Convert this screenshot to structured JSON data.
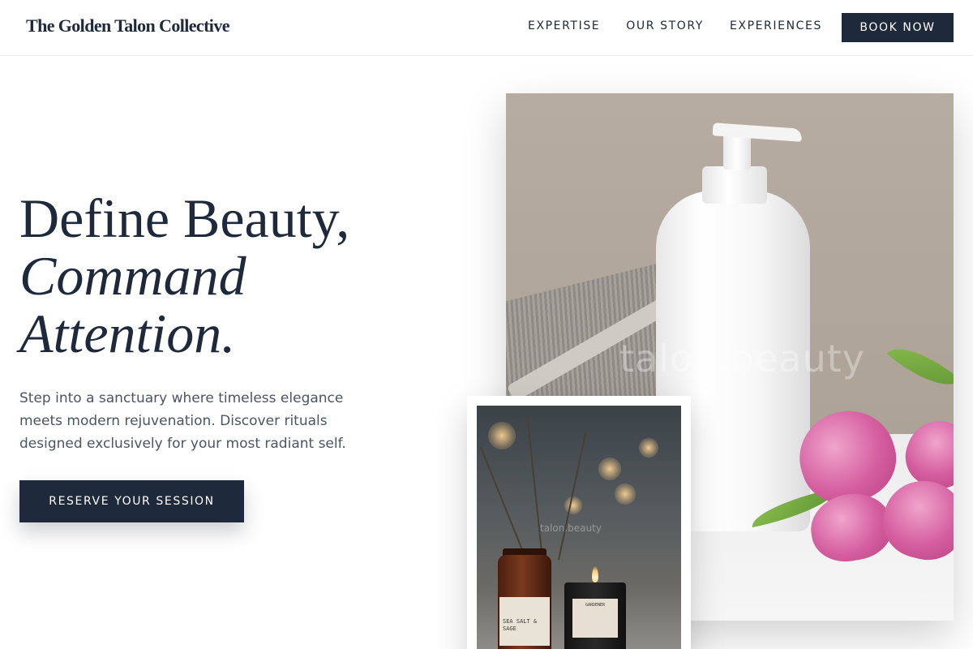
{
  "header": {
    "brand": "The Golden Talon Collective",
    "nav": [
      {
        "label": "EXPERTISE"
      },
      {
        "label": "OUR STORY"
      },
      {
        "label": "EXPERIENCES"
      }
    ],
    "book_label": "BOOK NOW"
  },
  "hero": {
    "headline_line1": "Define Beauty,",
    "headline_line2": "Command",
    "headline_line3": "Attention.",
    "subtext": "Step into a sanctuary where timeless elegance meets modern rejuvenation. Discover rituals designed exclusively for your most radiant self.",
    "cta_label": "RESERVE YOUR SESSION"
  },
  "images": {
    "main_watermark": "talon.beauty",
    "secondary_watermark": "talon.beauty",
    "jar_label": "SEA SALT & SAGE",
    "candle_label": "GARDENER"
  },
  "colors": {
    "primary": "#1e293b",
    "body_text": "#4b5563",
    "background": "#ffffff"
  }
}
